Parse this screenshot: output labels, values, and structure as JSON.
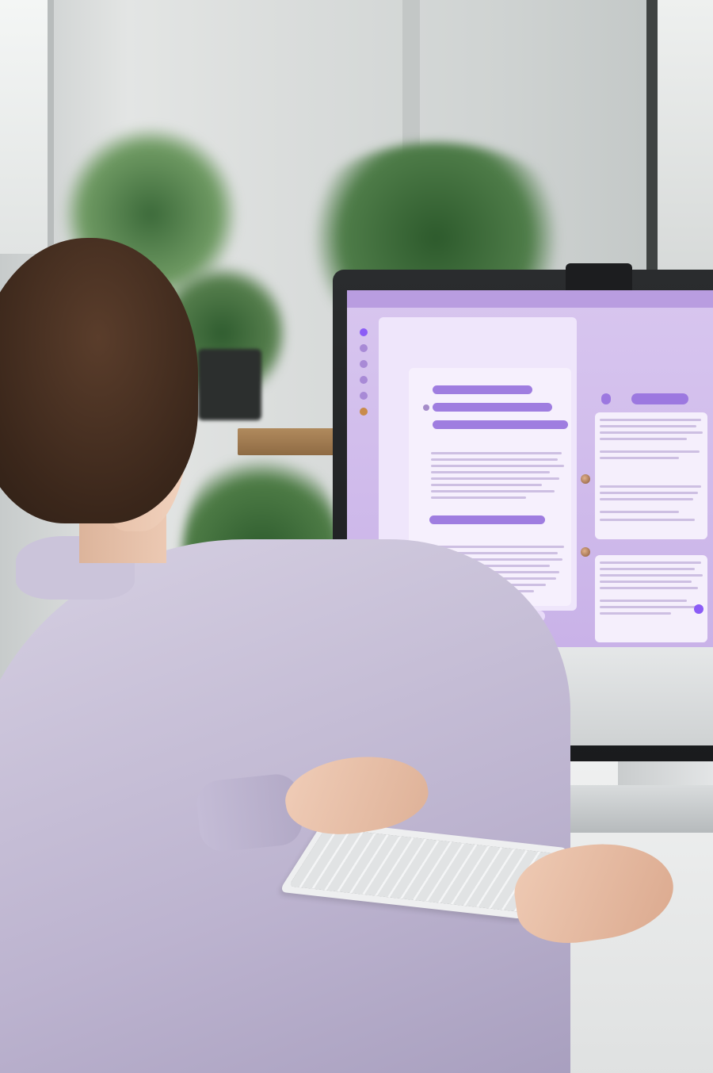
{
  "screen": {
    "window_title": "",
    "breadcrumb": "",
    "chat_title": "",
    "panel_heading": "",
    "chips": [
      "",
      ""
    ],
    "card_titles": [
      "",
      ""
    ],
    "thread_pills": [
      "",
      "",
      "",
      ""
    ],
    "thread_labels": [
      "",
      ""
    ]
  },
  "colors": {
    "accent": "#8b5cf6",
    "screen_bg": "#d8c6ef",
    "pill": "#9f7de0"
  }
}
